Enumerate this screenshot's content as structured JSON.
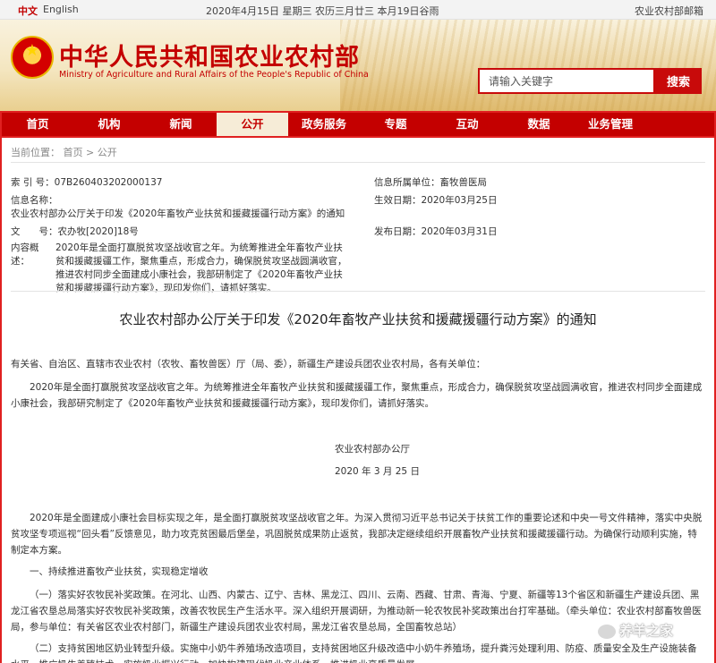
{
  "topbar": {
    "lang_zh": "中文",
    "lang_en": "English",
    "date": "2020年4月15日 星期三 农历三月廿三 本月19日谷雨",
    "mail": "农业农村部邮箱"
  },
  "header": {
    "title": "中华人民共和国农业农村部",
    "subtitle": "Ministry of Agriculture and Rural Affairs of the People's Republic of China",
    "search_placeholder": "请输入关键字",
    "search_button": "搜索"
  },
  "nav": {
    "items": [
      "首页",
      "机构",
      "新闻",
      "公开",
      "政务服务",
      "专题",
      "互动",
      "数据",
      "业务管理"
    ],
    "active_index": 3
  },
  "breadcrumb": "当前位置： 首页 > 公开",
  "meta": {
    "index_no": "索 引 号：07B260403202000137",
    "title_label": "信息名称：",
    "title_value": "农业农村部办公厅关于印发《2020年畜牧产业扶贫和援藏援疆行动方案》的通知",
    "doc_no": "文　　号：农办牧[2020]18号",
    "summary_label": "内容概述：",
    "summary_text": "2020年是全面打赢脱贫攻坚战收官之年。为统筹推进全年畜牧产业扶贫和援藏援疆工作，聚焦重点，形成合力，确保脱贫攻坚战圆满收官，推进农村同步全面建成小康社会，我部研制定了《2020年畜牧产业扶贫和援藏援疆行动方案》，现印发你们，请抓好落实。",
    "owner": "信息所属单位：畜牧兽医局",
    "effective_date": "生效日期：2020年03月25日",
    "publish_date": "发布日期：2020年03月31日"
  },
  "doc": {
    "title": "农业农村部办公厅关于印发《2020年畜牧产业扶贫和援藏援疆行动方案》的通知",
    "recipients": "有关省、自治区、直辖市农业农村（农牧、畜牧兽医）厅（局、委），新疆生产建设兵团农业农村局，各有关单位：",
    "intro": "2020年是全面打赢脱贫攻坚战收官之年。为统筹推进全年畜牧产业扶贫和援藏援疆工作，聚焦重点，形成合力，确保脱贫攻坚战圆满收官，推进农村同步全面建成小康社会，我部研究制定了《2020年畜牧产业扶贫和援藏援疆行动方案》，现印发你们，请抓好落实。",
    "signer": "农业农村部办公厅",
    "sign_date": "2020 年 3 月 25 日",
    "plan_intro": "2020年是全面建成小康社会目标实现之年，是全面打赢脱贫攻坚战收官之年。为深入贯彻习近平总书记关于扶贫工作的重要论述和中央一号文件精神，落实中央脱贫攻坚专项巡视“回头看”反馈意见，助力攻克贫困最后堡垒，巩固脱贫成果防止返贫，我部决定继续组织开展畜牧产业扶贫和援藏援疆行动。为确保行动顺利实施，特制定本方案。",
    "section1": "一、持续推进畜牧产业扶贫，实现稳定增收",
    "item1": "（一）落实好农牧民补奖政策。在河北、山西、内蒙古、辽宁、吉林、黑龙江、四川、云南、西藏、甘肃、青海、宁夏、新疆等13个省区和新疆生产建设兵团、黑龙江省农垦总局落实好农牧民补奖政策，改善农牧民生产生活水平。深入组织开展调研，为推动新一轮农牧民补奖政策出台打牢基础。（牵头单位：农业农村部畜牧兽医局，参与单位：有关省区农业农村部门，新疆生产建设兵团农业农村局，黑龙江省农垦总局，全国畜牧总站）",
    "item2": "（二）支持贫困地区奶业转型升级。实施中小奶牛养殖场改造项目，支持贫困地区升级改造中小奶牛养殖场，提升粪污处理利用、防疫、质量安全及生产设施装备水平。推广奶牛养殖技术，实施奶业振兴行动，加快构建现代奶业产业体系，推进奶业高质量发展。"
  },
  "watermark": "养羊之家"
}
